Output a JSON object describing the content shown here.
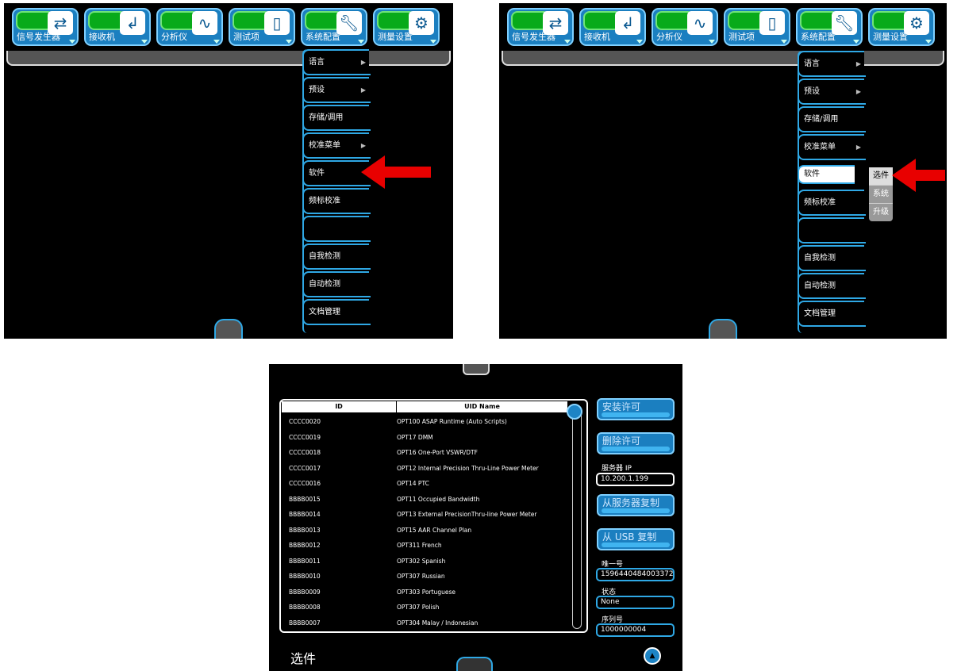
{
  "toolbar": {
    "buttons": [
      {
        "label": "信号发生器",
        "icon": "transfer-icon"
      },
      {
        "label": "接收机",
        "icon": "return-icon"
      },
      {
        "label": "分析仪",
        "icon": "waveform-icon"
      },
      {
        "label": "测试项",
        "icon": "probe-icon"
      },
      {
        "label": "系统配置",
        "icon": "wrench-icon"
      },
      {
        "label": "测量设置",
        "icon": "gear-icon"
      }
    ]
  },
  "system_menu": {
    "items": [
      {
        "label": "语言",
        "has_submenu": true
      },
      {
        "label": "预设",
        "has_submenu": true
      },
      {
        "label": "存储/调用",
        "has_submenu": false
      },
      {
        "label": "校准菜单",
        "has_submenu": true
      },
      {
        "label": "软件",
        "has_submenu": false
      },
      {
        "label": "频标校准",
        "has_submenu": false
      },
      {
        "label": "",
        "has_submenu": false
      },
      {
        "label": "自我检测",
        "has_submenu": false
      },
      {
        "label": "自动检测",
        "has_submenu": false
      },
      {
        "label": "文档管理",
        "has_submenu": false
      }
    ],
    "software_submenu": [
      "选件",
      "系统",
      "升级"
    ],
    "submenu_arrow_glyph": "▶"
  },
  "options_panel": {
    "columns": [
      "ID",
      "UID Name"
    ],
    "rows": [
      [
        "CCCC0020",
        "OPT100 ASAP Runtime (Auto Scripts)"
      ],
      [
        "CCCC0019",
        "OPT17 DMM"
      ],
      [
        "CCCC0018",
        "OPT16 One-Port VSWR/DTF"
      ],
      [
        "CCCC0017",
        "OPT12 Internal Precision Thru-Line Power Meter"
      ],
      [
        "CCCC0016",
        "OPT14 PTC"
      ],
      [
        "BBBB0015",
        "OPT11 Occupied Bandwidth"
      ],
      [
        "BBBB0014",
        "OPT13 External PrecisionThru-line Power Meter"
      ],
      [
        "BBBB0013",
        "OPT15 AAR Channel Plan"
      ],
      [
        "BBBB0012",
        "OPT311 French"
      ],
      [
        "BBBB0011",
        "OPT302 Spanish"
      ],
      [
        "BBBB0010",
        "OPT307 Russian"
      ],
      [
        "BBBB0009",
        "OPT303 Portuguese"
      ],
      [
        "BBBB0008",
        "OPT307 Polish"
      ],
      [
        "BBBB0007",
        "OPT304 Malay / Indonesian"
      ]
    ],
    "buttons": {
      "install": "安装许可",
      "delete": "删除许可",
      "copy_server": "从服务器复制",
      "copy_usb": "从 USB 复制"
    },
    "fields": {
      "server_ip_label": "服务器 IP",
      "server_ip": "10.200.1.199",
      "unique_label": "唯一号",
      "unique": "1596440484003372",
      "status_label": "状态",
      "status": "None",
      "serial_label": "序列号",
      "serial": "1000000004"
    },
    "title": "选件",
    "up_glyph": "▲"
  },
  "colors": {
    "accent": "#1b7fc0",
    "highlight": "#2fa8e5",
    "status_green": "#08aa1a",
    "pointer_red": "#e80000"
  }
}
